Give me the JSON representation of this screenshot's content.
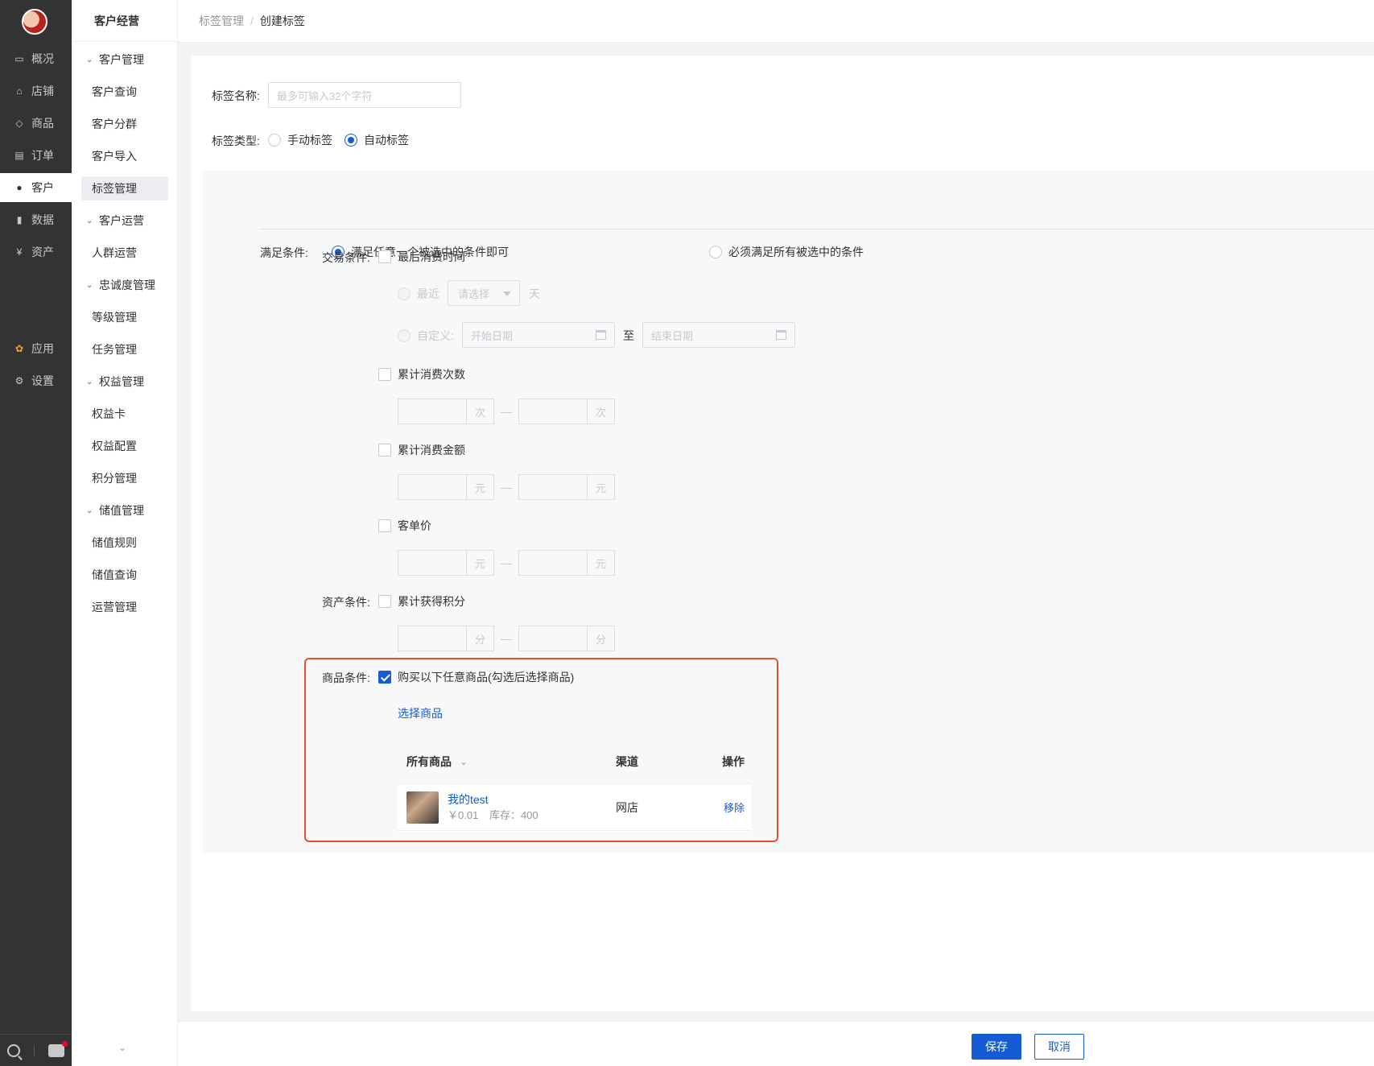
{
  "nav": {
    "items": [
      {
        "label": "概况",
        "icon": "monitor-icon"
      },
      {
        "label": "店铺",
        "icon": "store-icon"
      },
      {
        "label": "商品",
        "icon": "tag-icon"
      },
      {
        "label": "订单",
        "icon": "order-icon"
      },
      {
        "label": "客户",
        "icon": "user-icon"
      },
      {
        "label": "数据",
        "icon": "bar-chart-icon"
      },
      {
        "label": "资产",
        "icon": "yuan-icon"
      },
      {
        "label": "应用",
        "icon": "apps-icon"
      },
      {
        "label": "设置",
        "icon": "gear-icon"
      }
    ]
  },
  "sub": {
    "title": "客户经营",
    "items": [
      {
        "label": "客户管理",
        "type": "group"
      },
      {
        "label": "客户查询",
        "type": "leaf"
      },
      {
        "label": "客户分群",
        "type": "leaf"
      },
      {
        "label": "客户导入",
        "type": "leaf"
      },
      {
        "label": "标签管理",
        "type": "leaf"
      },
      {
        "label": "客户运营",
        "type": "group"
      },
      {
        "label": "人群运营",
        "type": "leaf"
      },
      {
        "label": "忠诚度管理",
        "type": "group"
      },
      {
        "label": "等级管理",
        "type": "leaf"
      },
      {
        "label": "任务管理",
        "type": "leaf"
      },
      {
        "label": "权益管理",
        "type": "group"
      },
      {
        "label": "权益卡",
        "type": "leaf"
      },
      {
        "label": "权益配置",
        "type": "leaf"
      },
      {
        "label": "积分管理",
        "type": "leaf"
      },
      {
        "label": "储值管理",
        "type": "group"
      },
      {
        "label": "储值规则",
        "type": "leaf"
      },
      {
        "label": "储值查询",
        "type": "leaf"
      },
      {
        "label": "运营管理",
        "type": "leaf"
      }
    ]
  },
  "header": {
    "crumb1": "标签管理",
    "sep": "/",
    "crumb2": "创建标签"
  },
  "form": {
    "name_label": "标签名称:",
    "name_placeholder": "最多可输入32个字符",
    "type_label": "标签类型:",
    "type_manual": "手动标签",
    "type_auto": "自动标签",
    "meet_label": "满足条件:",
    "meet_any": "满足任意一个被选中的条件即可",
    "meet_all": "必须满足所有被选中的条件",
    "trade_label": "交易条件:",
    "last_time": "最后消费时间",
    "recent": "最近",
    "select_placeholder": "请选择",
    "day": "天",
    "custom": "自定义:",
    "start_date": "开始日期",
    "to": "至",
    "end_date": "结束日期",
    "total_times": "累计消费次数",
    "unit_times": "次",
    "total_amount": "累计消费金额",
    "unit_yuan": "元",
    "avg_price": "客单价",
    "dash": "—",
    "asset_label": "资产条件:",
    "total_points": "累计获得积分",
    "unit_points": "分",
    "goods_label": "商品条件:",
    "goods_option": "购买以下任意商品(勾选后选择商品)",
    "choose_goods": "选择商品",
    "table": {
      "col_goods": "所有商品",
      "col_channel": "渠道",
      "col_action": "操作",
      "rows": [
        {
          "name": "我的test",
          "price": "￥0.01",
          "stock": "库存：400",
          "channel": "网店",
          "action": "移除"
        }
      ]
    }
  },
  "footer": {
    "save": "保存",
    "cancel": "取消"
  },
  "colors": {
    "primary": "#155bd4",
    "nav_bg": "#333333",
    "highlight": "#e94e2c"
  }
}
